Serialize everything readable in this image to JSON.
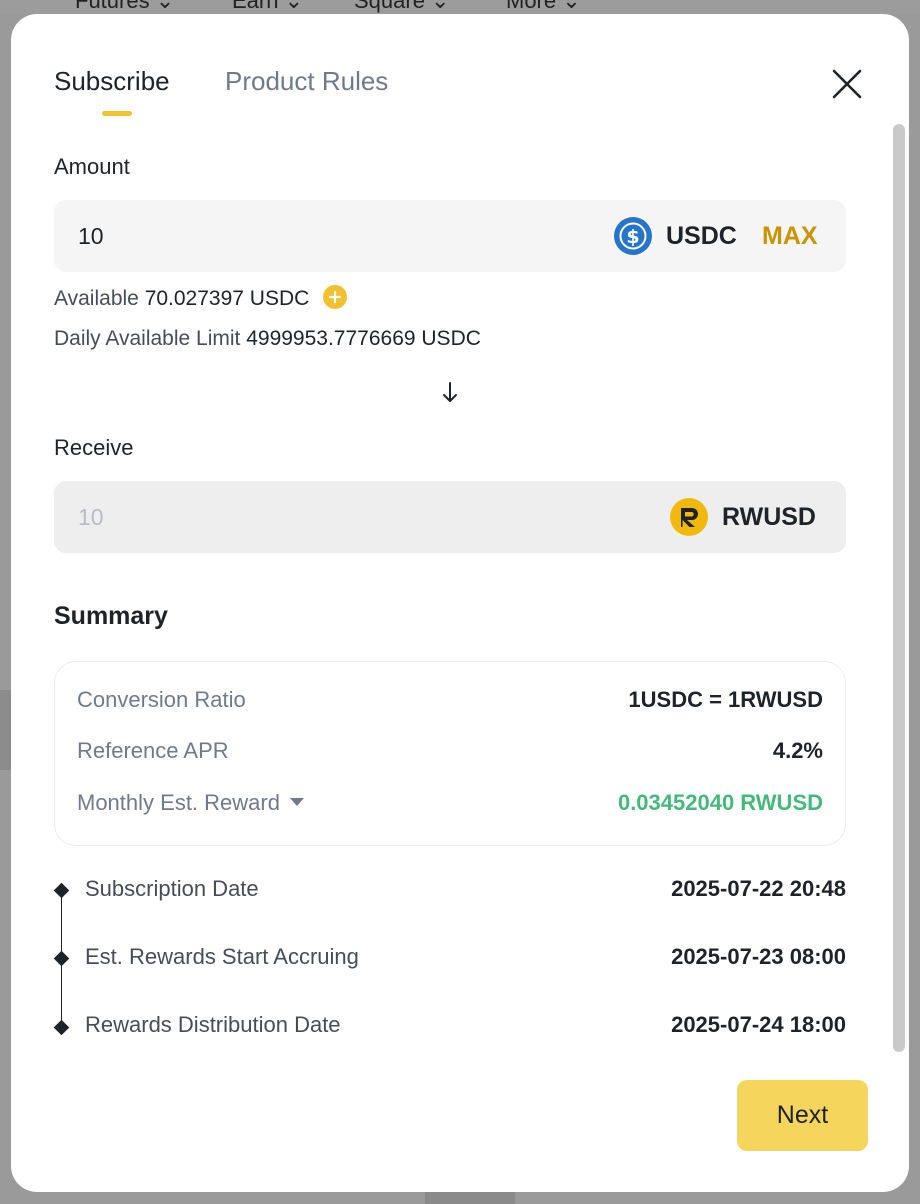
{
  "background_nav": {
    "items": [
      "Futures ⌄",
      "Earn ⌄",
      "Square ⌄",
      "More ⌄"
    ]
  },
  "tabs": {
    "subscribe": "Subscribe",
    "product_rules": "Product Rules"
  },
  "amount": {
    "label": "Amount",
    "value": "10",
    "coin": "USDC",
    "max_label": "MAX",
    "available_label": "Available",
    "available_value": "70.027397 USDC",
    "daily_limit_label": "Daily Available Limit",
    "daily_limit_value": "4999953.7776669 USDC"
  },
  "receive": {
    "label": "Receive",
    "value": "10",
    "coin": "RWUSD"
  },
  "summary": {
    "title": "Summary",
    "rows": [
      {
        "label": "Conversion Ratio",
        "value": "1USDC = 1RWUSD"
      },
      {
        "label": "Reference APR",
        "value": "4.2%"
      },
      {
        "label": "Monthly Est. Reward",
        "value": "0.03452040 RWUSD"
      }
    ]
  },
  "timeline": [
    {
      "label": "Subscription Date",
      "value": "2025-07-22 20:48"
    },
    {
      "label": "Est. Rewards Start Accruing",
      "value": "2025-07-23 08:00"
    },
    {
      "label": "Rewards Distribution Date",
      "value": "2025-07-24 18:00"
    }
  ],
  "actions": {
    "next_label": "Next"
  },
  "colors": {
    "accent": "#f0c232",
    "max": "#c99400",
    "reward_green": "#45b97c",
    "usdc_blue": "#2775ca",
    "next_button": "#f5d55b"
  },
  "icons": {
    "close": "close-icon",
    "usdc": "usdc-coin-icon",
    "rwusd": "rwusd-coin-icon",
    "plus": "plus-icon",
    "arrow": "arrow-down-icon",
    "caret": "caret-down-icon"
  }
}
